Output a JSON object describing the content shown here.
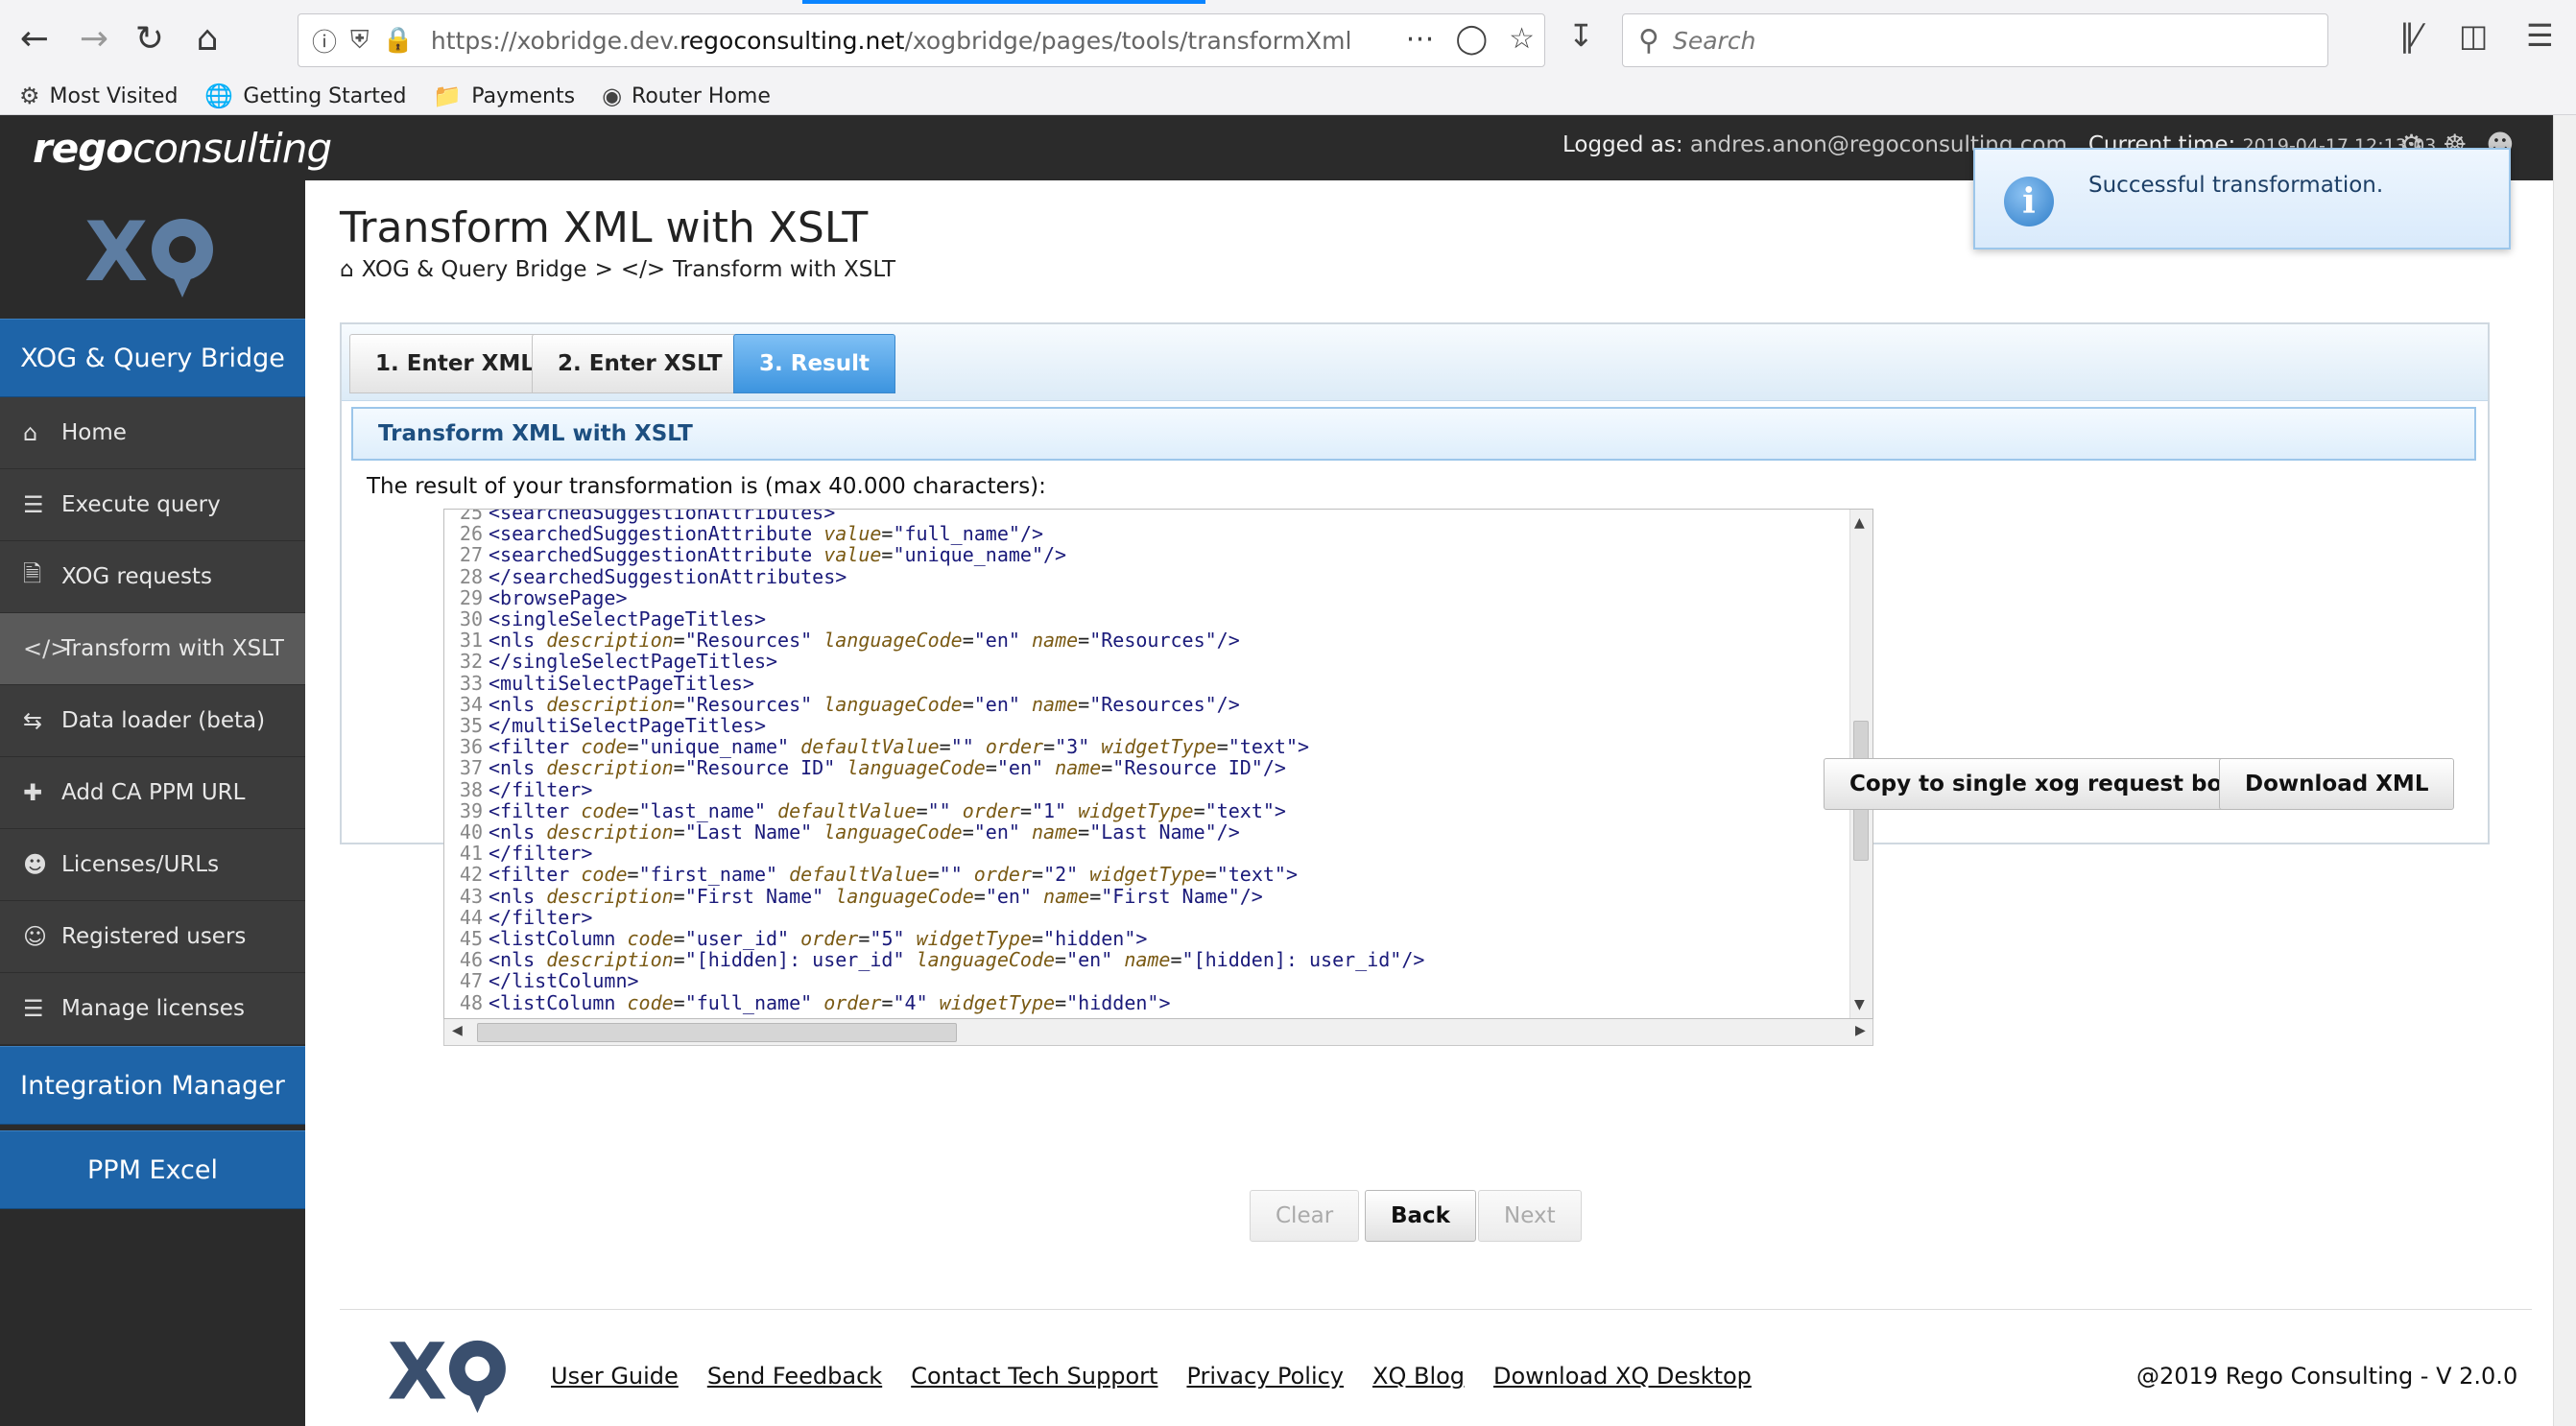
{
  "browser": {
    "url_prefix": "https://xobridge.dev.",
    "url_domain": "regoconsulting.net",
    "url_path": "/xogbridge/pages/tools/transformXmlWithX",
    "search_placeholder": "Search",
    "bookmarks": [
      {
        "label": "Most Visited",
        "icon": "gear-icon"
      },
      {
        "label": "Getting Started",
        "icon": "globe-icon"
      },
      {
        "label": "Payments",
        "icon": "folder-icon"
      },
      {
        "label": "Router Home",
        "icon": "router-icon"
      }
    ]
  },
  "header": {
    "logo_bold": "rego",
    "logo_rest": "consulting",
    "logged_label": "Logged as:",
    "logged_user": "andres.anon@regoconsulting.com",
    "time_label": "Current time:",
    "time_value": "2019-04-17 12:13:03"
  },
  "sidebar": {
    "logo_text": "XQ",
    "section_top": "XOG & Query Bridge",
    "items": [
      {
        "label": "Home",
        "icon": "home-icon"
      },
      {
        "label": "Execute query",
        "icon": "database-icon"
      },
      {
        "label": "XOG requests",
        "icon": "file-code-icon"
      },
      {
        "label": "Transform with XSLT",
        "icon": "code-icon"
      },
      {
        "label": "Data loader (beta)",
        "icon": "exchange-icon"
      },
      {
        "label": "Add CA PPM URL",
        "icon": "plus-icon"
      },
      {
        "label": "Licenses/URLs",
        "icon": "user-icon"
      },
      {
        "label": "Registered users",
        "icon": "users-icon"
      },
      {
        "label": "Manage licenses",
        "icon": "list-icon"
      }
    ],
    "section_integration": "Integration Manager",
    "section_excel": "PPM Excel"
  },
  "main": {
    "title": "Transform XML with XSLT",
    "breadcrumb_home": "XOG & Query Bridge",
    "breadcrumb_sep": ">",
    "breadcrumb_current": "Transform with XSLT",
    "tabs": [
      {
        "label": "1. Enter XML"
      },
      {
        "label": "2. Enter XSLT"
      },
      {
        "label": "3. Result"
      }
    ],
    "active_tab": "3. Result",
    "sub_header": "Transform XML with XSLT",
    "result_label": "The result of your transformation is (max 40.000 characters):",
    "buttons": {
      "copy": "Copy to single xog request box",
      "download": "Download XML",
      "clear": "Clear",
      "back": "Back",
      "next": "Next"
    }
  },
  "code_lines": [
    {
      "n": "25",
      "text": "<searchedSuggestionAttributes>"
    },
    {
      "n": "26",
      "tag": "<searchedSuggestionAttribute",
      "parts": [
        [
          "value",
          "\"full_name\""
        ]
      ],
      "end": "/>"
    },
    {
      "n": "27",
      "tag": "<searchedSuggestionAttribute",
      "parts": [
        [
          "value",
          "\"unique_name\""
        ]
      ],
      "end": "/>"
    },
    {
      "n": "28",
      "text": "</searchedSuggestionAttributes>"
    },
    {
      "n": "29",
      "text": "<browsePage>"
    },
    {
      "n": "30",
      "text": "<singleSelectPageTitles>"
    },
    {
      "n": "31",
      "tag": "<nls",
      "parts": [
        [
          "description",
          "\"Resources\""
        ],
        [
          "languageCode",
          "\"en\""
        ],
        [
          "name",
          "\"Resources\""
        ]
      ],
      "end": "/>"
    },
    {
      "n": "32",
      "text": "</singleSelectPageTitles>"
    },
    {
      "n": "33",
      "text": "<multiSelectPageTitles>"
    },
    {
      "n": "34",
      "tag": "<nls",
      "parts": [
        [
          "description",
          "\"Resources\""
        ],
        [
          "languageCode",
          "\"en\""
        ],
        [
          "name",
          "\"Resources\""
        ]
      ],
      "end": "/>"
    },
    {
      "n": "35",
      "text": "</multiSelectPageTitles>"
    },
    {
      "n": "36",
      "tag": "<filter",
      "parts": [
        [
          "code",
          "\"unique_name\""
        ],
        [
          "defaultValue",
          "\"\""
        ],
        [
          "order",
          "\"3\""
        ],
        [
          "widgetType",
          "\"text\""
        ]
      ],
      "end": ">"
    },
    {
      "n": "37",
      "tag": "<nls",
      "parts": [
        [
          "description",
          "\"Resource ID\""
        ],
        [
          "languageCode",
          "\"en\""
        ],
        [
          "name",
          "\"Resource ID\""
        ]
      ],
      "end": "/>"
    },
    {
      "n": "38",
      "text": "</filter>"
    },
    {
      "n": "39",
      "tag": "<filter",
      "parts": [
        [
          "code",
          "\"last_name\""
        ],
        [
          "defaultValue",
          "\"\""
        ],
        [
          "order",
          "\"1\""
        ],
        [
          "widgetType",
          "\"text\""
        ]
      ],
      "end": ">"
    },
    {
      "n": "40",
      "tag": "<nls",
      "parts": [
        [
          "description",
          "\"Last Name\""
        ],
        [
          "languageCode",
          "\"en\""
        ],
        [
          "name",
          "\"Last Name\""
        ]
      ],
      "end": "/>"
    },
    {
      "n": "41",
      "text": "</filter>"
    },
    {
      "n": "42",
      "tag": "<filter",
      "parts": [
        [
          "code",
          "\"first_name\""
        ],
        [
          "defaultValue",
          "\"\""
        ],
        [
          "order",
          "\"2\""
        ],
        [
          "widgetType",
          "\"text\""
        ]
      ],
      "end": ">"
    },
    {
      "n": "43",
      "tag": "<nls",
      "parts": [
        [
          "description",
          "\"First Name\""
        ],
        [
          "languageCode",
          "\"en\""
        ],
        [
          "name",
          "\"First Name\""
        ]
      ],
      "end": "/>"
    },
    {
      "n": "44",
      "text": "</filter>"
    },
    {
      "n": "45",
      "tag": "<listColumn",
      "parts": [
        [
          "code",
          "\"user_id\""
        ],
        [
          "order",
          "\"5\""
        ],
        [
          "widgetType",
          "\"hidden\""
        ]
      ],
      "end": ">"
    },
    {
      "n": "46",
      "tag": "<nls",
      "parts": [
        [
          "description",
          "\"[hidden]: user_id\""
        ],
        [
          "languageCode",
          "\"en\""
        ],
        [
          "name",
          "\"[hidden]: user_id\""
        ]
      ],
      "end": "/>"
    },
    {
      "n": "47",
      "text": "</listColumn>"
    },
    {
      "n": "48",
      "tag": "<listColumn",
      "parts": [
        [
          "code",
          "\"full_name\""
        ],
        [
          "order",
          "\"4\""
        ],
        [
          "widgetType",
          "\"hidden\""
        ]
      ],
      "end": ">"
    }
  ],
  "toast": {
    "message": "Successful transformation."
  },
  "footer": {
    "links": [
      "User Guide",
      "Send Feedback",
      "Contact Tech Support",
      "Privacy Policy",
      "XQ Blog",
      "Download XQ Desktop"
    ],
    "copyright": "@2019 Rego Consulting - V 2.0.0"
  },
  "colors": {
    "accent": "#1e64a8",
    "active_tab": "#3c94df",
    "sidebar_bg": "#2b2b2b"
  }
}
